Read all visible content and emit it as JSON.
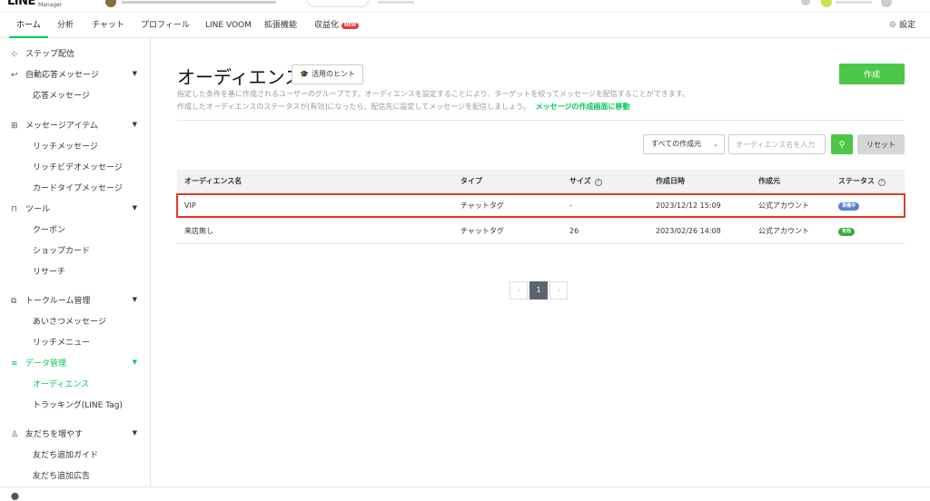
{
  "nav": {
    "tabs": [
      {
        "label": "ホーム"
      },
      {
        "label": "分析"
      },
      {
        "label": "チャット"
      },
      {
        "label": "プロフィール"
      },
      {
        "label": "LINE VOOM"
      },
      {
        "label": "拡張機能"
      },
      {
        "label": "収益化"
      }
    ],
    "new_badge": "NEW",
    "settings_label": "設定",
    "active_tab": "ホーム"
  },
  "sidebar": {
    "groups": [
      {
        "label": "ステップ配信"
      },
      {
        "label": "自動応答メッセージ",
        "items": [
          "応答メッセージ"
        ]
      },
      {
        "label": "メッセージアイテム",
        "items": [
          "リッチメッセージ",
          "リッチビデオメッセージ",
          "カードタイプメッセージ"
        ]
      },
      {
        "label": "ツール",
        "items": [
          "クーポン",
          "ショップカード",
          "リサーチ"
        ]
      },
      {
        "label": "トークルーム管理",
        "items": [
          "あいさつメッセージ",
          "リッチメニュー"
        ]
      },
      {
        "label": "データ管理",
        "items": [
          "オーディエンス",
          "トラッキング(LINE Tag)"
        ]
      },
      {
        "label": "友だちを増やす",
        "items": [
          "友だち追加ガイド",
          "友だち追加広告"
        ]
      }
    ],
    "active_item": "オーディエンス"
  },
  "main": {
    "title": "オーディエンス",
    "hint_button": "活用のヒント",
    "create_button": "作成",
    "description_line1": "指定した条件を基に作成されるユーザーのグループです。オーディエンスを設定することにより、ターゲットを絞ってメッセージを配信することができます。",
    "description_line2": "作成したオーディエンスのステータスが[有効]になったら、配信先に設定してメッセージを配信しましょう。",
    "description_link": "メッセージの作成画面に移動",
    "filter_select": "すべての作成元",
    "search_placeholder": "オーディエンス名を入力",
    "reset_button": "リセット",
    "table": {
      "headers": [
        "オーディエンス名",
        "タイプ",
        "サイズ",
        "作成日時",
        "作成元",
        "ステータス"
      ],
      "rows": [
        {
          "name": "VIP",
          "type": "チャットタグ",
          "size": "-",
          "created": "2023/12/12 15:09",
          "source": "公式アカウント",
          "status": "準備中",
          "status_color": "#5a7fd6"
        },
        {
          "name": "来店無し",
          "type": "チャットタグ",
          "size": "26",
          "created": "2023/02/26 14:08",
          "source": "公式アカウント",
          "status": "有効",
          "status_color": "#3aaa35"
        }
      ]
    },
    "pagination": {
      "current_page": "1"
    }
  },
  "colors": {
    "accent": "#06c755",
    "button_green": "#4cc747",
    "highlight_box": "#e0392b"
  }
}
